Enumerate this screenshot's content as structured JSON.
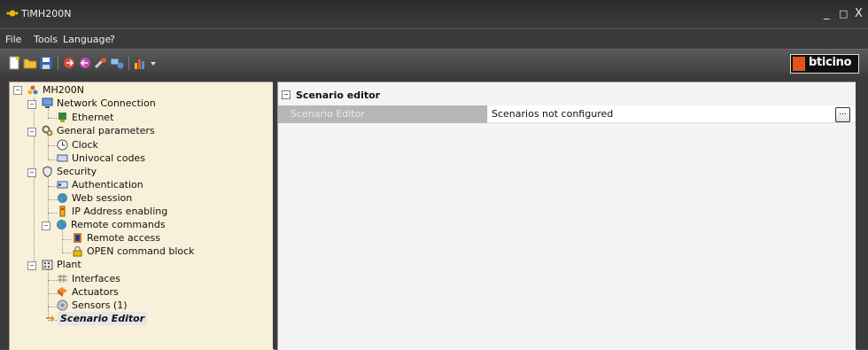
{
  "window": {
    "title": "TiMH200N",
    "minimize": "_",
    "maximize": "□",
    "close": "X"
  },
  "menu": [
    "File",
    "Tools",
    "Language",
    "?"
  ],
  "toolbar": {
    "icons": [
      "new-icon",
      "open-icon",
      "save-icon",
      "send-icon",
      "receive-icon",
      "tools-icon",
      "network-icon",
      "chart-icon",
      "dropdown-arrow-icon"
    ],
    "logo_text": "bticino",
    "accent": "#e2541e"
  },
  "tree": {
    "root": "MH200N",
    "network": "Network Connection",
    "ethernet": "Ethernet",
    "general": "General parameters",
    "clock": "Clock",
    "univocal": "Univocal codes",
    "security": "Security",
    "authentication": "Authentication",
    "web_session": "Web session",
    "ip_enabling": "IP Address enabling",
    "remote_commands": "Remote commands",
    "remote_access": "Remote access",
    "open_block": "OPEN command block",
    "plant": "Plant",
    "interfaces": "Interfaces",
    "actuators": "Actuators",
    "sensors": "Sensors (1)",
    "scenario_editor": "Scenario Editor"
  },
  "panel": {
    "section_title": "Scenario editor",
    "property_name": "Scenario Editor",
    "property_value": "Scenarios not configured",
    "browse_label": "..."
  }
}
